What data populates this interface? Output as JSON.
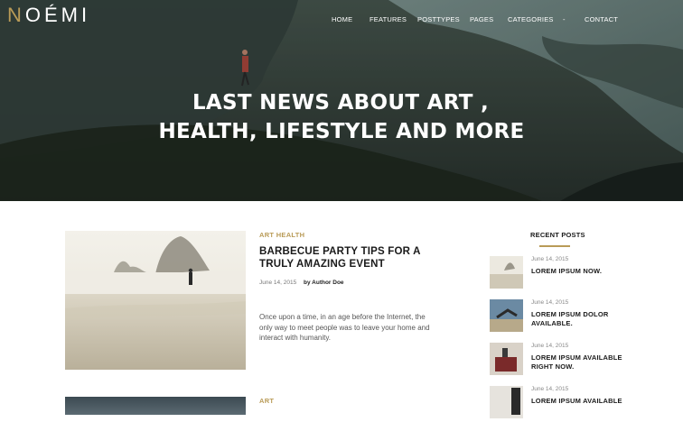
{
  "brand": {
    "logo_first": "N",
    "logo_rest": "OÉMI"
  },
  "nav": {
    "items": [
      {
        "label": "HOME"
      },
      {
        "label": "FEATURES"
      },
      {
        "label": "POSTTYPES"
      },
      {
        "label": "PAGES"
      },
      {
        "label": "CATEGORIES"
      },
      {
        "label": "-"
      },
      {
        "label": "CONTACT"
      }
    ]
  },
  "hero": {
    "title_line1": "LAST NEWS ABOUT ART ,",
    "title_line2": "HEALTH, LIFESTYLE AND MORE"
  },
  "posts": [
    {
      "category": "ART HEALTH",
      "title": "BARBECUE PARTY TIPS FOR A TRULY AMAZING EVENT",
      "date": "June 14, 2015",
      "author": "by Author Doe",
      "excerpt": "Once upon a time, in an age before the Internet, the only way to meet people was to leave your home and interact with humanity."
    },
    {
      "category": "ART"
    }
  ],
  "sidebar": {
    "title": "RECENT POSTS",
    "posts": [
      {
        "date": "June 14, 2015",
        "title": "LOREM IPSUM NOW."
      },
      {
        "date": "June 14, 2015",
        "title": "LOREM IPSUM DOLOR AVAILABLE."
      },
      {
        "date": "June 14, 2015",
        "title": "LOREM IPSUM AVAILABLE RIGHT NOW."
      },
      {
        "date": "June 14, 2015",
        "title": "LOREM IPSUM AVAILABLE"
      }
    ]
  },
  "colors": {
    "accent": "#b99b57",
    "hero_dark": "#27322d",
    "text_dark": "#1a1a1a"
  }
}
